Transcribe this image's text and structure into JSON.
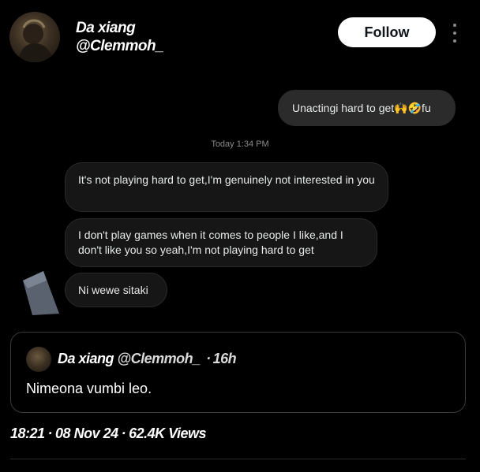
{
  "profile": {
    "display_name": "Da xiang",
    "handle": "@Clemmoh_",
    "follow_label": "Follow"
  },
  "chat": {
    "outgoing_message": "Unactingi hard to get🙌🤣fu",
    "timestamp": "Today 1:34 PM",
    "incoming_messages": [
      "It's not playing hard to get,I'm genuinely not interested in you",
      "I don't play games when it comes to people I like,and I don't like you so yeah,I'm not playing hard to get",
      "Ni wewe sitaki"
    ]
  },
  "quoted_tweet": {
    "display_name": "Da xiang",
    "handle": "@Clemmoh_",
    "separator": "·",
    "age": "16h",
    "text": "Nimeona vumbi leo."
  },
  "post_meta": {
    "time": "18:21",
    "date": "08 Nov 24",
    "views": "62.4K",
    "views_label": "Views",
    "separator": "·"
  }
}
